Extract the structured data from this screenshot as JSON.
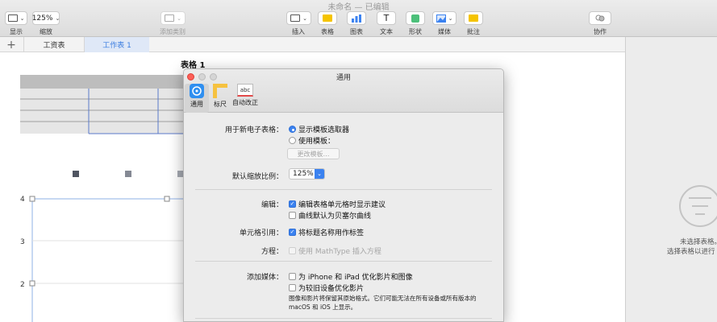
{
  "window": {
    "title": "未命名 — 已编辑"
  },
  "toolbar": {
    "view_label": "显示",
    "zoom_value": "125%",
    "zoom_label": "缩放",
    "add_category_label": "添加类别",
    "insert_label": "插入",
    "table_label": "表格",
    "chart_label": "图表",
    "text_label": "文本",
    "shape_label": "形状",
    "media_label": "媒体",
    "comment_label": "批注",
    "collaborate_label": "协作"
  },
  "tabs": [
    {
      "label": "工资表"
    },
    {
      "label": "工作表 1"
    }
  ],
  "canvas": {
    "table_title": "表格 1",
    "axis_labels": [
      "4",
      "3",
      "2"
    ]
  },
  "right_panel": {
    "line1": "未选择表格。",
    "line2": "选择表格以进行"
  },
  "prefs": {
    "title": "通用",
    "tabs": [
      {
        "label": "通用"
      },
      {
        "label": "标尺"
      },
      {
        "label": "自动改正"
      }
    ],
    "autocorrect_icon_text": "abc",
    "new_sheet_label": "用于新电子表格：",
    "show_template_chooser": "显示模板选取器",
    "use_template": "使用模板：",
    "change_template_button": "更改模板…",
    "default_zoom_label": "默认缩放比例：",
    "default_zoom_value": "125%",
    "editing_label": "编辑：",
    "show_suggestions": "编辑表格单元格时显示建议",
    "bezier_curves": "曲线默认为贝塞尔曲线",
    "cell_refs_label": "单元格引用：",
    "use_header_names": "将标题名称用作标签",
    "equations_label": "方程：",
    "mathtype": "使用 MathType 插入方程",
    "add_media_label": "添加媒体：",
    "optimize_iphone": "为 iPhone 和 iPad 优化影片和图像",
    "optimize_old": "为较旧设备优化影片",
    "media_note": "图像和影片将保留其原始格式。它们可能无法在所有设备或所有版本的 macOS 和 iOS 上显示。",
    "checkbox_glyph": "✓"
  },
  "colors": {
    "accent": "#3b82f0",
    "tab_selected": "#3b7de0"
  }
}
